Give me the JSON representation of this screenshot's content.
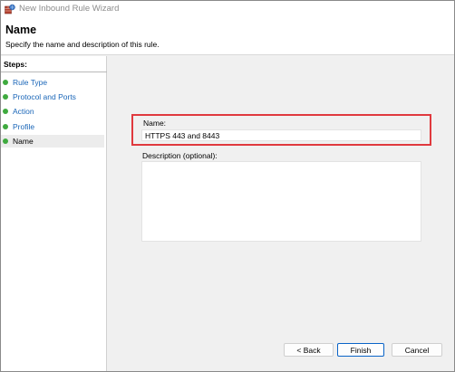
{
  "window": {
    "title": "New Inbound Rule Wizard",
    "icon": "firewall-shield-icon"
  },
  "header": {
    "title": "Name",
    "description": "Specify the name and description of this rule."
  },
  "steps": {
    "heading": "Steps:",
    "items": [
      {
        "label": "Rule Type",
        "selected": false
      },
      {
        "label": "Protocol and Ports",
        "selected": false
      },
      {
        "label": "Action",
        "selected": false
      },
      {
        "label": "Profile",
        "selected": false
      },
      {
        "label": "Name",
        "selected": true
      }
    ],
    "dot_color": "#3faa3f",
    "link_color": "#1a66b8"
  },
  "form": {
    "name_label": "Name:",
    "name_value": "HTTPS 443 and 8443",
    "description_label": "Description (optional):",
    "description_value": ""
  },
  "buttons": {
    "back": "< Back",
    "finish": "Finish",
    "cancel": "Cancel"
  },
  "colors": {
    "highlight": "#e0393e",
    "finish_border": "#0a64c8"
  }
}
